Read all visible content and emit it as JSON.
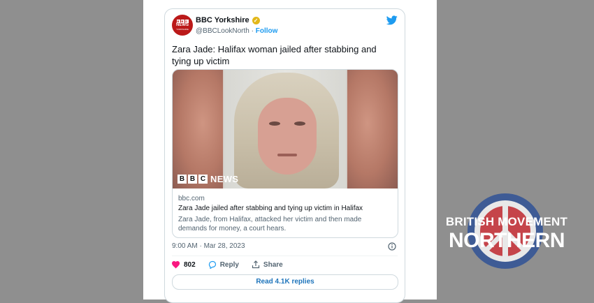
{
  "tweet": {
    "account_name": "BBC Yorkshire",
    "handle": "@BBCLookNorth",
    "separator": " · ",
    "follow_label": "Follow",
    "text": "Zara Jade: Halifax woman jailed after stabbing and tying up victim",
    "avatar": {
      "bbc": [
        "B",
        "B",
        "C"
      ],
      "news": "NEWS",
      "region": "YORKSHIRE"
    },
    "timestamp": "9:00 AM · Mar 28, 2023",
    "like_count": "802",
    "reply_label": "Reply",
    "share_label": "Share",
    "read_replies_label": "Read 4.1K replies"
  },
  "link_card": {
    "image_brand": {
      "blocks": [
        "B",
        "B",
        "C"
      ],
      "news": "NEWS"
    },
    "domain": "bbc.com",
    "headline": "Zara Jade jailed after stabbing and tying up victim in Halifax",
    "description": "Zara Jade, from Halifax, attacked her victim and then made demands for money, a court hears."
  },
  "watermark": {
    "line1": "BRITISH MOVEMENT",
    "line2": "NORTHERN"
  },
  "colors": {
    "twitter_blue": "#1d9bf0",
    "bbc_red": "#bb1919",
    "like_pink": "#f91880",
    "verified_gold": "#e2b719",
    "background_gray": "#8f8f8f"
  },
  "icons": [
    "bbc-avatar-icon",
    "verified-badge-icon",
    "twitter-bird-icon",
    "info-icon",
    "heart-icon",
    "reply-icon",
    "share-icon",
    "roundel-icon"
  ]
}
